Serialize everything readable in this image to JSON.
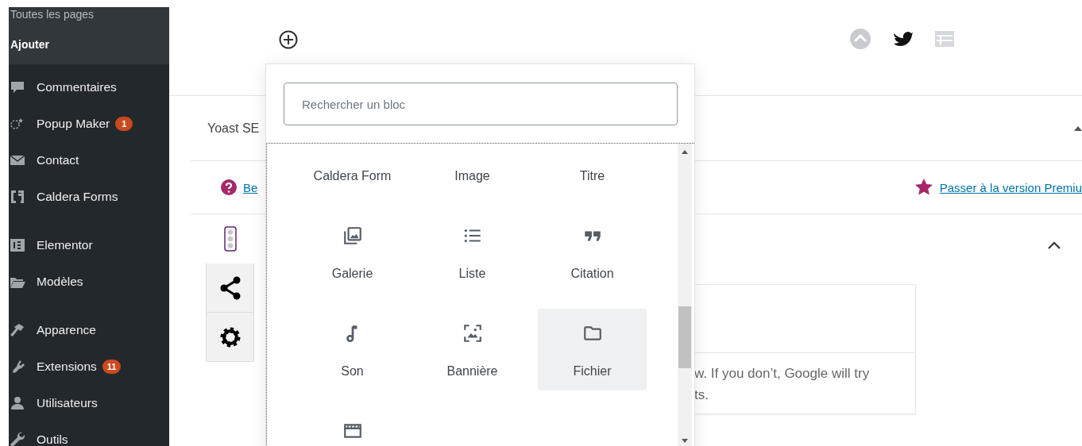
{
  "sidebar": {
    "submenu": [
      {
        "label": "Toutes les pages",
        "selected": false
      },
      {
        "label": "Ajouter",
        "selected": true
      }
    ],
    "items": [
      {
        "label": "Commentaires"
      },
      {
        "label": "Popup Maker",
        "badge": "1"
      },
      {
        "label": "Contact"
      },
      {
        "label": "Caldera Forms"
      },
      {
        "label": "Elementor"
      },
      {
        "label": "Modèles"
      },
      {
        "label": "Apparence"
      },
      {
        "label": "Extensions",
        "badge": "11"
      },
      {
        "label": "Utilisateurs"
      },
      {
        "label": "Outils"
      }
    ]
  },
  "yoast": {
    "title": "Yoast SE",
    "help_link": "Be",
    "premium_link": "Passer à la version Premiu",
    "tabs": [
      {
        "selected": true
      },
      {
        "selected": false
      },
      {
        "selected": false
      }
    ],
    "card_lines": [
      "w. If you don’t, Google will try",
      "ts."
    ]
  },
  "inserter": {
    "search": {
      "placeholder": "Rechercher un bloc"
    },
    "blocks": [
      {
        "label": "Caldera Form",
        "selected": false
      },
      {
        "label": "Image",
        "selected": false
      },
      {
        "label": "Titre",
        "selected": false
      },
      {
        "label": "Galerie",
        "selected": false
      },
      {
        "label": "Liste",
        "selected": false
      },
      {
        "label": "Citation",
        "selected": false
      },
      {
        "label": "Son",
        "selected": false
      },
      {
        "label": "Bannière",
        "selected": false
      },
      {
        "label": "Fichier",
        "selected": true
      },
      {
        "selected": false
      }
    ]
  }
}
